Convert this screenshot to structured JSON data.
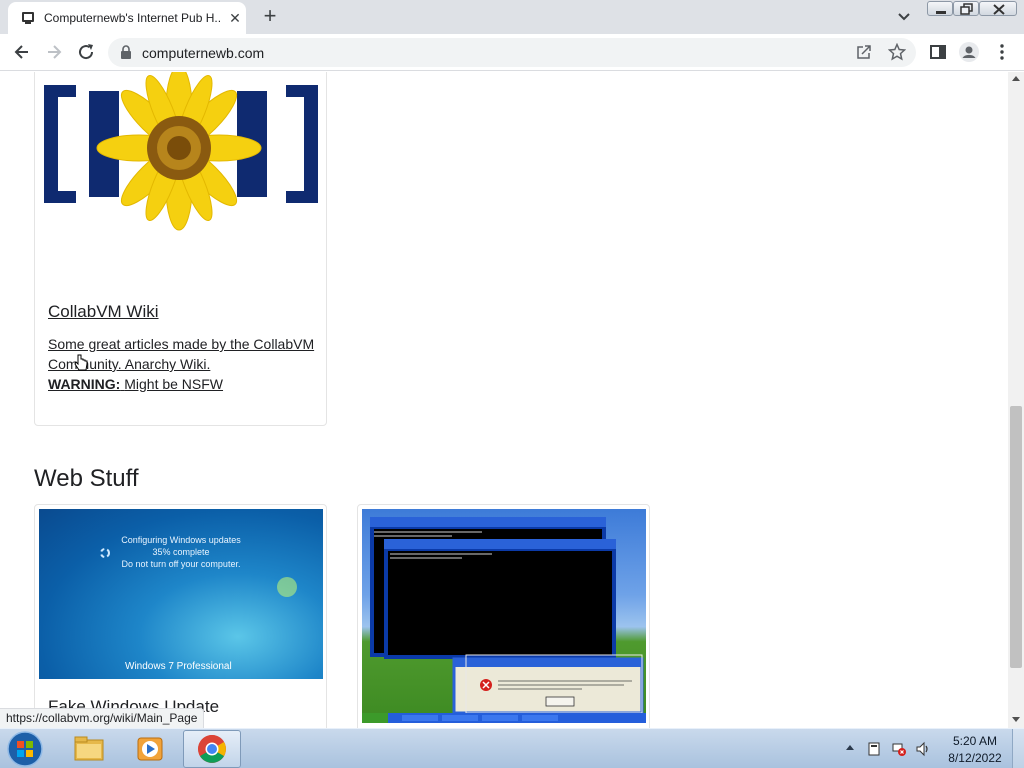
{
  "browser": {
    "tab_title": "Computernewb's Internet Pub H...",
    "tab_close": "✕",
    "new_tab": "+",
    "url": "computernewb.com"
  },
  "page": {
    "wiki_card": {
      "title": "CollabVM Wiki",
      "description": "Some great articles made by the CollabVM Community. Anarchy Wiki.",
      "warning_label": "WARNING:",
      "warning_text": "Might be NSFW"
    },
    "section_heading": "Web Stuff",
    "update_card": {
      "image_line1": "Configuring Windows updates",
      "image_line2": "35% complete",
      "image_line3": "Do not turn off your computer.",
      "image_brand": "Windows 7 Professional",
      "title": "Fake Windows Update"
    },
    "status_url": "https://collabvm.org/wiki/Main_Page"
  },
  "taskbar": {
    "apps": [
      "windows-explorer",
      "media-player",
      "google-chrome"
    ],
    "clock_time": "5:20 AM",
    "clock_date": "8/12/2022"
  },
  "colors": {
    "tab_strip": "#dee1e6",
    "omnibox": "#f1f3f4",
    "taskbar": "#b9cde5"
  }
}
